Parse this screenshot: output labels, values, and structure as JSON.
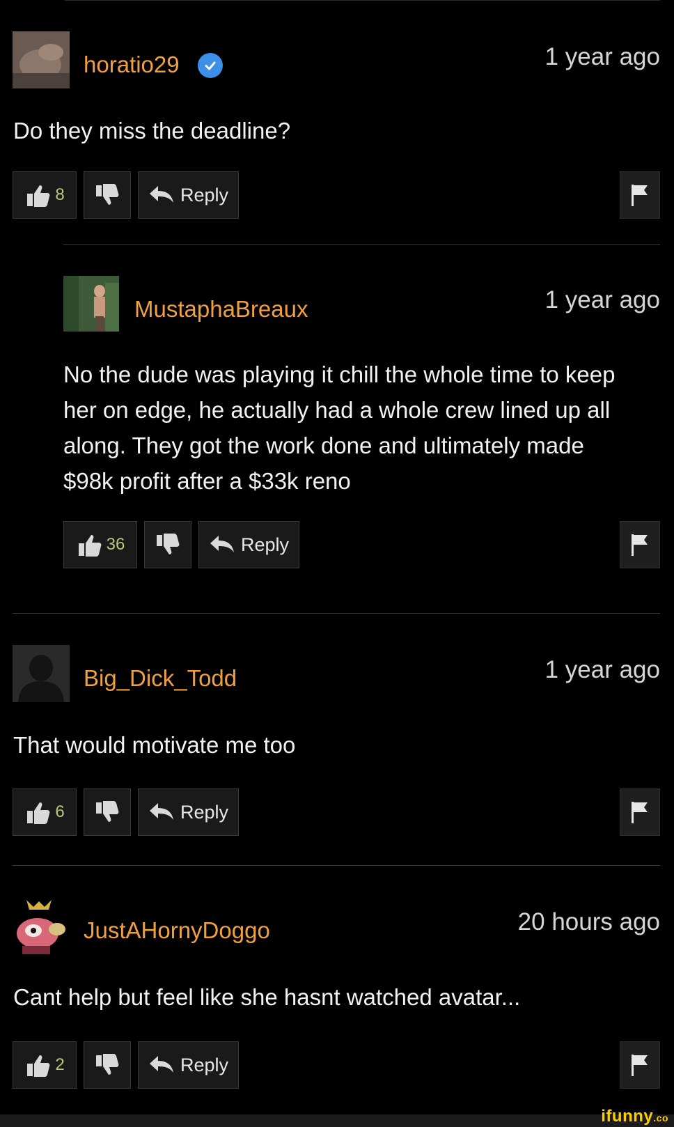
{
  "comments": [
    {
      "username": "horatio29",
      "verified": true,
      "time": "1 year ago",
      "text": "Do they miss the deadline?",
      "likes": "8",
      "reply_label": "Reply"
    },
    {
      "username": "MustaphaBreaux",
      "verified": false,
      "time": "1 year ago",
      "text": "No the dude was playing it chill the whole time to keep her on edge, he actually had a whole crew lined up all along. They got the work done and ultimately made $98k profit after a $33k reno",
      "likes": "36",
      "reply_label": "Reply"
    },
    {
      "username": "Big_Dick_Todd",
      "verified": false,
      "time": "1 year ago",
      "text": "That would motivate me too",
      "likes": "6",
      "reply_label": "Reply"
    },
    {
      "username": "JustAHornyDoggo",
      "verified": false,
      "time": "20 hours ago",
      "text": "Cant help but feel like she hasnt watched avatar...",
      "likes": "2",
      "reply_label": "Reply"
    }
  ],
  "watermark": {
    "brand": "ifunny",
    "suffix": ".co"
  },
  "colors": {
    "username": "#f0a040",
    "likes": "#b9c874",
    "verified": "#3d8fe8",
    "background": "#000000"
  },
  "icons": [
    "verified-badge-icon",
    "thumbs-up-icon",
    "thumbs-down-icon",
    "reply-arrow-icon",
    "flag-icon"
  ]
}
